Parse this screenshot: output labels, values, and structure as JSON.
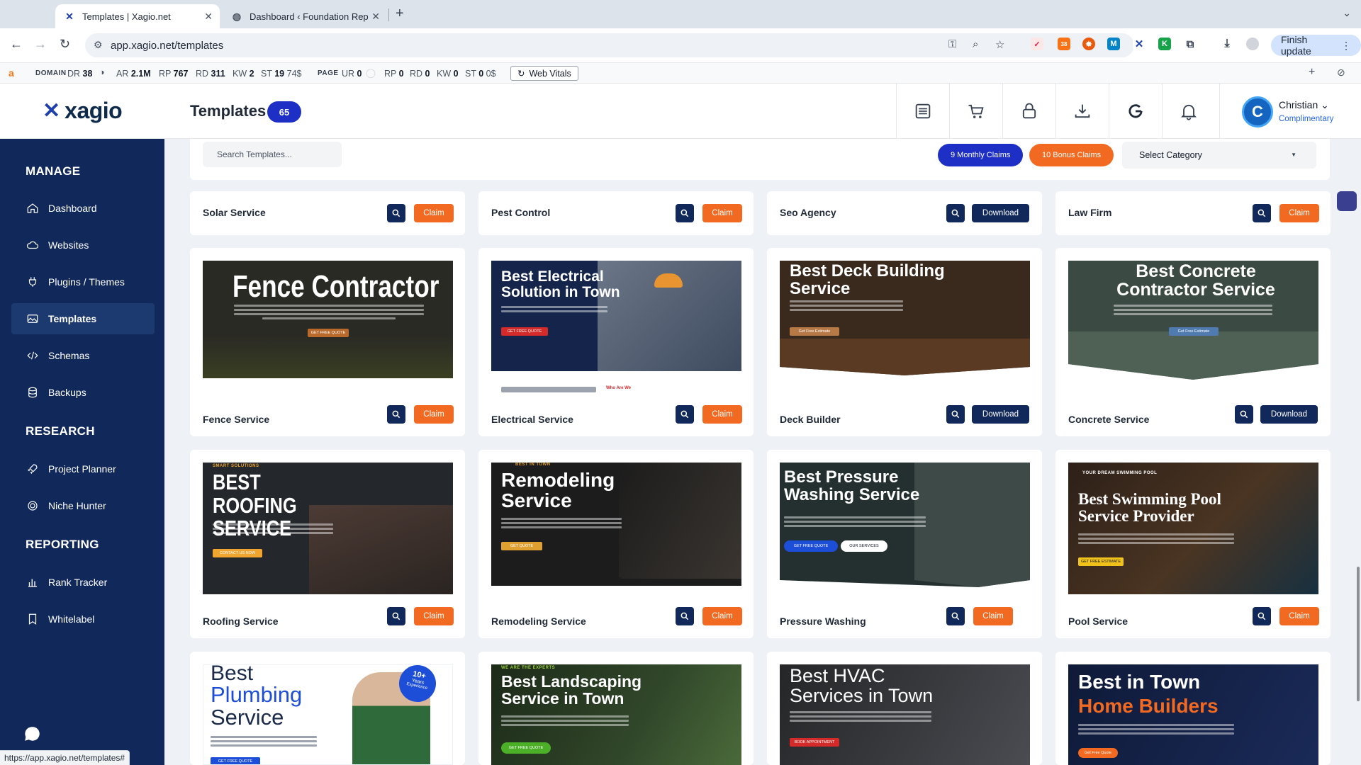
{
  "browser": {
    "tabs": [
      {
        "title": "Templates | Xagio.net",
        "active": true
      },
      {
        "title": "Dashboard ‹ Foundation Rep",
        "active": false
      }
    ],
    "url": "app.xagio.net/templates",
    "finish_update_label": "Finish update",
    "extension_badge": "38"
  },
  "seo_bar": {
    "domain_label": "DOMAIN",
    "dr_label": "DR",
    "dr_value": "38",
    "ar_label": "AR",
    "ar_value": "2.1M",
    "rp_label": "RP",
    "rp_value": "767",
    "rd_label": "RD",
    "rd_value": "311",
    "kw_label": "KW",
    "kw_value": "2",
    "st_label": "ST",
    "st_value": "19",
    "st_extra": "74$",
    "page_label": "PAGE",
    "ur_label": "UR",
    "ur_value": "0",
    "prp_label": "RP",
    "prp_value": "0",
    "prd_label": "RD",
    "prd_value": "0",
    "pkw_label": "KW",
    "pkw_value": "0",
    "pst_label": "ST",
    "pst_value": "0",
    "pst_extra": "0$",
    "web_vitals_label": "Web Vitals"
  },
  "header": {
    "logo_text": "xagio",
    "page_title": "Templates",
    "template_count": "65",
    "user_name": "Christian",
    "user_plan": "Complimentary",
    "avatar_letter": "C"
  },
  "sidebar": {
    "sections": [
      {
        "title": "MANAGE",
        "items": [
          {
            "label": "Dashboard",
            "icon": "home-icon"
          },
          {
            "label": "Websites",
            "icon": "cloud-icon"
          },
          {
            "label": "Plugins / Themes",
            "icon": "plug-icon"
          },
          {
            "label": "Templates",
            "icon": "image-icon",
            "active": true
          },
          {
            "label": "Schemas",
            "icon": "code-icon"
          },
          {
            "label": "Backups",
            "icon": "database-icon"
          }
        ]
      },
      {
        "title": "RESEARCH",
        "items": [
          {
            "label": "Project Planner",
            "icon": "rocket-icon"
          },
          {
            "label": "Niche Hunter",
            "icon": "target-icon"
          }
        ]
      },
      {
        "title": "REPORTING",
        "items": [
          {
            "label": "Rank Tracker",
            "icon": "bar-chart-icon"
          },
          {
            "label": "Whitelabel",
            "icon": "bookmark-icon"
          }
        ]
      }
    ]
  },
  "filters": {
    "search_placeholder": "Search Templates...",
    "monthly_claims": "9 Monthly Claims",
    "bonus_claims": "10 Bonus Claims",
    "category_select": "Select Category"
  },
  "templates": [
    {
      "name": "Solar Service",
      "action": "Claim"
    },
    {
      "name": "Pest Control",
      "action": "Claim"
    },
    {
      "name": "Seo Agency",
      "action": "Download"
    },
    {
      "name": "Law Firm",
      "action": "Claim"
    },
    {
      "name": "Fence Service",
      "action": "Claim",
      "hero": "Fence Contractor",
      "cta": "GET FREE QUOTE"
    },
    {
      "name": "Electrical Service",
      "action": "Claim",
      "hero": "Best Electrical Solution in Town",
      "cta": "GET FREE QUOTE",
      "below": "Who Are We"
    },
    {
      "name": "Deck Builder",
      "action": "Download",
      "hero": "Best Deck Building Service",
      "cta": "Get Free Estimate"
    },
    {
      "name": "Concrete Service",
      "action": "Download",
      "hero": "Best Concrete Contractor Service",
      "cta": "Get Free Estimate"
    },
    {
      "name": "Roofing Service",
      "action": "Claim",
      "hero": "BEST ROOFING SERVICE",
      "eyebrow": "SMART SOLUTIONS",
      "cta": "CONTACT US NOW"
    },
    {
      "name": "Remodeling Service",
      "action": "Claim",
      "hero": "Remodeling Service",
      "eyebrow": "BEST IN TOWN",
      "cta": "GET QUOTE"
    },
    {
      "name": "Pressure Washing",
      "action": "Claim",
      "hero": "Best Pressure Washing Service",
      "cta": "GET FREE QUOTE",
      "cta2": "OUR SERVICES"
    },
    {
      "name": "Pool Service",
      "action": "Claim",
      "hero": "Best Swimming Pool Service Provider",
      "eyebrow": "YOUR DREAM SWIMMING POOL",
      "cta": "GET FREE ESTIMATE"
    },
    {
      "name": "",
      "hero1": "Best",
      "hero2": "Plumbing",
      "hero3": "Service",
      "badge1": "10+",
      "badge2": "Years",
      "badge3": "Experience",
      "cta": "GET FREE QUOTE"
    },
    {
      "name": "",
      "hero": "Best Landscaping Service in Town",
      "eyebrow": "WE ARE THE EXPERTS",
      "cta": "GET FREE QUOTE"
    },
    {
      "name": "",
      "hero": "Best HVAC Services in Town",
      "cta": "BOOK APPOINTMENT"
    },
    {
      "name": "",
      "hero1": "Best in Town",
      "hero2": "Home Builders",
      "cta": "Get Free Quote"
    }
  ],
  "status_url": "https://app.xagio.net/templates#",
  "colors": {
    "sidebar": "#11285a",
    "claim": "#f26a21",
    "download": "#11285a",
    "accent_blue": "#1d2fc4"
  }
}
